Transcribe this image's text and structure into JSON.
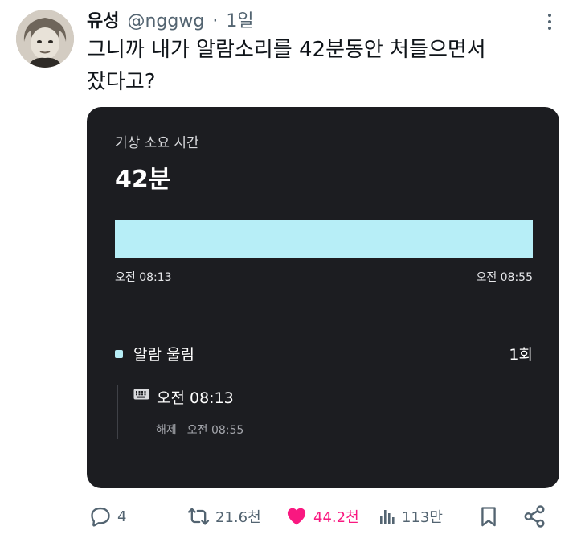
{
  "author": {
    "display_name": "유성",
    "handle": "@nggwg",
    "separator": "·",
    "time": "1일"
  },
  "tweet": {
    "text": "그니까 내가 알람소리를 42분동안 처들으면서\n잤다고?"
  },
  "card": {
    "label": "기상 소요 시간",
    "value": "42분",
    "bar_fill_fraction": 1.0,
    "start_time": "오전 08:13",
    "end_time": "오전 08:55",
    "alarm": {
      "title": "알람 울림",
      "count": "1회",
      "entry_time": "오전 08:13",
      "dismiss_label": "해제",
      "dismiss_time": "오전 08:55"
    },
    "colors": {
      "background": "#1c1d21",
      "accent": "#b7eef7"
    }
  },
  "actions": {
    "replies": "4",
    "retweets": "21.6천",
    "likes": "44.2천",
    "views": "113만",
    "like_color": "#f91880"
  }
}
